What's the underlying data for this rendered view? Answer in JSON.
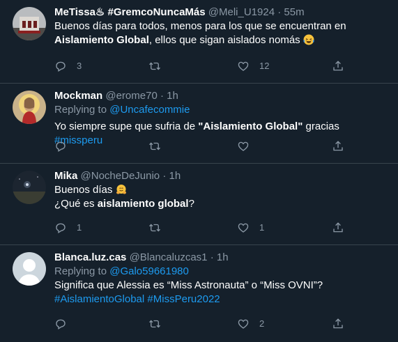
{
  "tweets": [
    {
      "name": "MeTissa♨ #GremcoNuncaMás",
      "handle": "@Meli_U1924",
      "time": "55m",
      "text_a": "Buenos días para todos, menos para los que se encuentran en ",
      "text_bold": "Aislamiento Global",
      "text_b": ", ellos que sigan aislados nomás",
      "emoji": "laughing-tears",
      "replies": "3",
      "retweets": "",
      "likes": "12"
    },
    {
      "name": "Mockman",
      "handle": "@erome70",
      "time": "1h",
      "replying_prefix": "Replying to ",
      "replying_to": "@Uncafecommie",
      "text_a": "Yo siempre supe que sufria de ",
      "text_bold": "\"Aislamiento Global\"",
      "text_b": " gracias ",
      "hashtag": "#missperu",
      "replies": "",
      "retweets": "",
      "likes": ""
    },
    {
      "name": "Mika",
      "handle": "@NocheDeJunio",
      "time": "1h",
      "line1": "Buenos días",
      "emoji": "hugging",
      "line2_a": "¿Qué es ",
      "line2_bold": "aislamiento global",
      "line2_b": "?",
      "replies": "1",
      "retweets": "",
      "likes": "1"
    },
    {
      "name": "Blanca.luz.cas",
      "handle": "@Blancaluzcas1",
      "time": "1h",
      "replying_prefix": "Replying to ",
      "replying_to": "@Galo59661980",
      "text": "Significa que Alessia es “Miss Astronauta” o “Miss OVNI”?",
      "hashtag1": "#AislamientoGlobal",
      "hashtag2": "#MissPeru2022",
      "replies": "",
      "retweets": "",
      "likes": "2"
    }
  ],
  "separator": "·",
  "colors": {
    "background": "#15202b",
    "muted": "#8b98a5",
    "link": "#1d9bf0",
    "divider": "#38444d"
  }
}
